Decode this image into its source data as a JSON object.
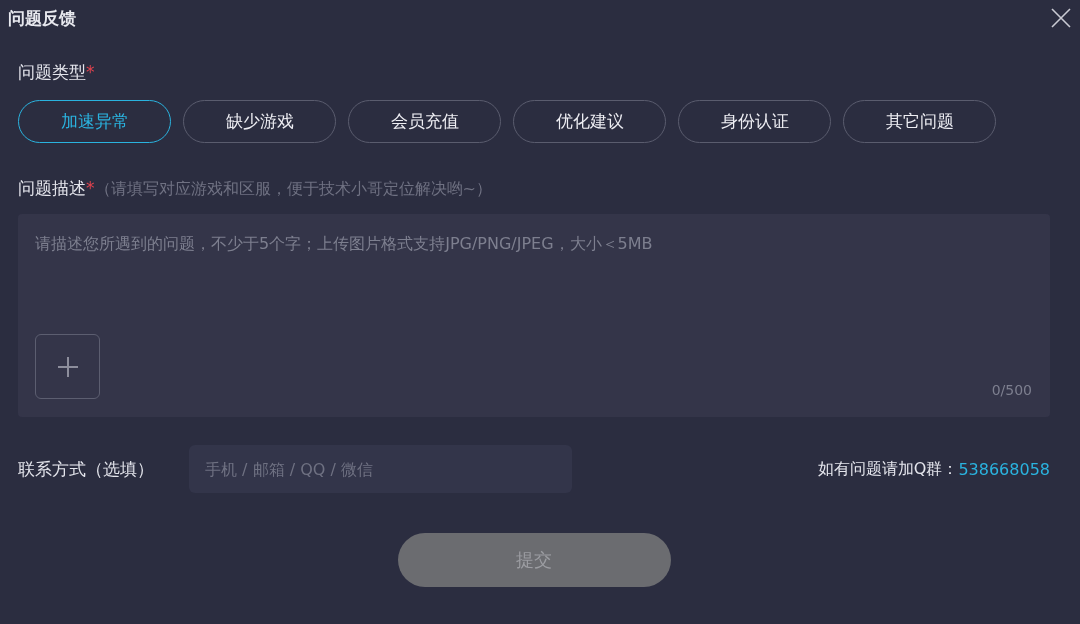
{
  "window": {
    "title": "问题反馈"
  },
  "type_section": {
    "label": "问题类型",
    "required_mark": "*",
    "options": [
      {
        "label": "加速异常",
        "selected": true
      },
      {
        "label": "缺少游戏",
        "selected": false
      },
      {
        "label": "会员充值",
        "selected": false
      },
      {
        "label": "优化建议",
        "selected": false
      },
      {
        "label": "身份认证",
        "selected": false
      },
      {
        "label": "其它问题",
        "selected": false
      }
    ]
  },
  "description": {
    "label": "问题描述",
    "required_mark": "*",
    "hint": "（请填写对应游戏和区服，便于技术小哥定位解决哟~）",
    "placeholder": "请描述您所遇到的问题，不少于5个字；上传图片格式支持JPG/PNG/JPEG，大小＜5MB",
    "counter": "0/500"
  },
  "contact": {
    "label": "联系方式（选填）",
    "placeholder": "手机 / 邮箱 / QQ / 微信"
  },
  "qq_group": {
    "label": "如有问题请加Q群：",
    "number": "538668058"
  },
  "submit": {
    "label": "提交",
    "disabled": true
  }
}
